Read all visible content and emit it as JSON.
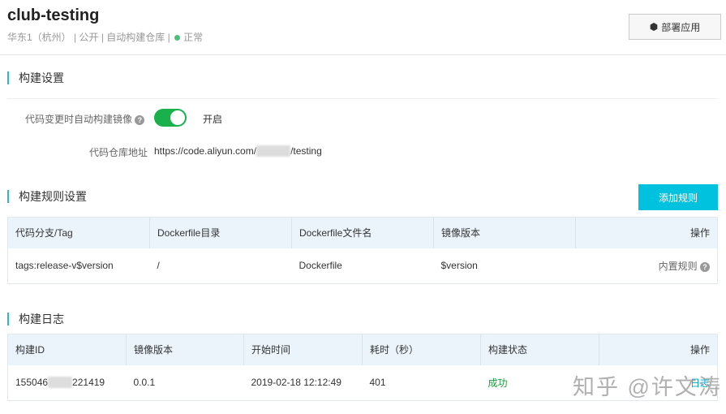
{
  "header": {
    "title": "club-testing",
    "region": "华东1（杭州）",
    "visibility": "公开",
    "type": "自动构建仓库",
    "status": "正常",
    "deploy_label": "部署应用",
    "status_color": "#4cbf7a"
  },
  "build_settings": {
    "title": "构建设置",
    "auto_build_label": "代码变更时自动构建镜像",
    "auto_build_enabled": true,
    "auto_build_state": "开启",
    "repo_label": "代码仓库地址",
    "repo_url_prefix": "https://code.aliyun.com/",
    "repo_url_suffix": "/testing"
  },
  "rules": {
    "title": "构建规则设置",
    "add_label": "添加规则",
    "columns": [
      "代码分支/Tag",
      "Dockerfile目录",
      "Dockerfile文件名",
      "镜像版本",
      "操作"
    ],
    "rows": [
      {
        "branch": "tags:release-v$version",
        "dir": "/",
        "file": "Dockerfile",
        "version": "$version",
        "action": "内置规则"
      }
    ]
  },
  "logs": {
    "title": "构建日志",
    "columns": [
      "构建ID",
      "镜像版本",
      "开始时间",
      "耗时（秒）",
      "构建状态",
      "操作"
    ],
    "rows": [
      {
        "id_prefix": "155046",
        "id_suffix": "221419",
        "version": "0.0.1",
        "start": "2019-02-18 12:12:49",
        "duration": "401",
        "status": "成功",
        "action": "日志"
      }
    ]
  },
  "watermark": "知乎 @许文涛"
}
